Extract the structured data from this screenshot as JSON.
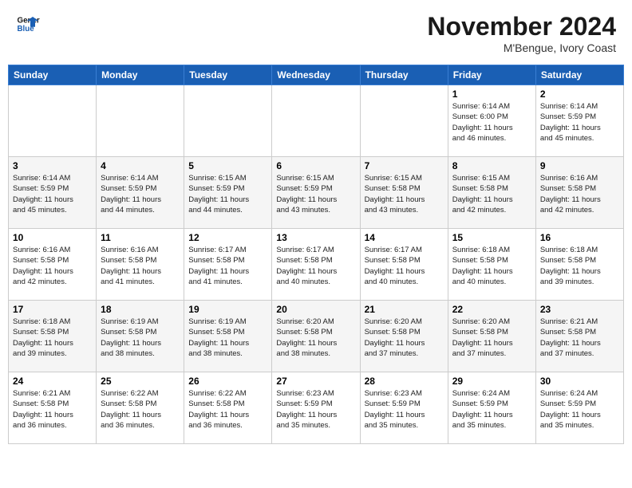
{
  "header": {
    "logo_line1": "General",
    "logo_line2": "Blue",
    "month": "November 2024",
    "location": "M'Bengue, Ivory Coast"
  },
  "days_of_week": [
    "Sunday",
    "Monday",
    "Tuesday",
    "Wednesday",
    "Thursday",
    "Friday",
    "Saturday"
  ],
  "weeks": [
    [
      {
        "day": "",
        "info": ""
      },
      {
        "day": "",
        "info": ""
      },
      {
        "day": "",
        "info": ""
      },
      {
        "day": "",
        "info": ""
      },
      {
        "day": "",
        "info": ""
      },
      {
        "day": "1",
        "info": "Sunrise: 6:14 AM\nSunset: 6:00 PM\nDaylight: 11 hours\nand 46 minutes."
      },
      {
        "day": "2",
        "info": "Sunrise: 6:14 AM\nSunset: 5:59 PM\nDaylight: 11 hours\nand 45 minutes."
      }
    ],
    [
      {
        "day": "3",
        "info": "Sunrise: 6:14 AM\nSunset: 5:59 PM\nDaylight: 11 hours\nand 45 minutes."
      },
      {
        "day": "4",
        "info": "Sunrise: 6:14 AM\nSunset: 5:59 PM\nDaylight: 11 hours\nand 44 minutes."
      },
      {
        "day": "5",
        "info": "Sunrise: 6:15 AM\nSunset: 5:59 PM\nDaylight: 11 hours\nand 44 minutes."
      },
      {
        "day": "6",
        "info": "Sunrise: 6:15 AM\nSunset: 5:59 PM\nDaylight: 11 hours\nand 43 minutes."
      },
      {
        "day": "7",
        "info": "Sunrise: 6:15 AM\nSunset: 5:58 PM\nDaylight: 11 hours\nand 43 minutes."
      },
      {
        "day": "8",
        "info": "Sunrise: 6:15 AM\nSunset: 5:58 PM\nDaylight: 11 hours\nand 42 minutes."
      },
      {
        "day": "9",
        "info": "Sunrise: 6:16 AM\nSunset: 5:58 PM\nDaylight: 11 hours\nand 42 minutes."
      }
    ],
    [
      {
        "day": "10",
        "info": "Sunrise: 6:16 AM\nSunset: 5:58 PM\nDaylight: 11 hours\nand 42 minutes."
      },
      {
        "day": "11",
        "info": "Sunrise: 6:16 AM\nSunset: 5:58 PM\nDaylight: 11 hours\nand 41 minutes."
      },
      {
        "day": "12",
        "info": "Sunrise: 6:17 AM\nSunset: 5:58 PM\nDaylight: 11 hours\nand 41 minutes."
      },
      {
        "day": "13",
        "info": "Sunrise: 6:17 AM\nSunset: 5:58 PM\nDaylight: 11 hours\nand 40 minutes."
      },
      {
        "day": "14",
        "info": "Sunrise: 6:17 AM\nSunset: 5:58 PM\nDaylight: 11 hours\nand 40 minutes."
      },
      {
        "day": "15",
        "info": "Sunrise: 6:18 AM\nSunset: 5:58 PM\nDaylight: 11 hours\nand 40 minutes."
      },
      {
        "day": "16",
        "info": "Sunrise: 6:18 AM\nSunset: 5:58 PM\nDaylight: 11 hours\nand 39 minutes."
      }
    ],
    [
      {
        "day": "17",
        "info": "Sunrise: 6:18 AM\nSunset: 5:58 PM\nDaylight: 11 hours\nand 39 minutes."
      },
      {
        "day": "18",
        "info": "Sunrise: 6:19 AM\nSunset: 5:58 PM\nDaylight: 11 hours\nand 38 minutes."
      },
      {
        "day": "19",
        "info": "Sunrise: 6:19 AM\nSunset: 5:58 PM\nDaylight: 11 hours\nand 38 minutes."
      },
      {
        "day": "20",
        "info": "Sunrise: 6:20 AM\nSunset: 5:58 PM\nDaylight: 11 hours\nand 38 minutes."
      },
      {
        "day": "21",
        "info": "Sunrise: 6:20 AM\nSunset: 5:58 PM\nDaylight: 11 hours\nand 37 minutes."
      },
      {
        "day": "22",
        "info": "Sunrise: 6:20 AM\nSunset: 5:58 PM\nDaylight: 11 hours\nand 37 minutes."
      },
      {
        "day": "23",
        "info": "Sunrise: 6:21 AM\nSunset: 5:58 PM\nDaylight: 11 hours\nand 37 minutes."
      }
    ],
    [
      {
        "day": "24",
        "info": "Sunrise: 6:21 AM\nSunset: 5:58 PM\nDaylight: 11 hours\nand 36 minutes."
      },
      {
        "day": "25",
        "info": "Sunrise: 6:22 AM\nSunset: 5:58 PM\nDaylight: 11 hours\nand 36 minutes."
      },
      {
        "day": "26",
        "info": "Sunrise: 6:22 AM\nSunset: 5:58 PM\nDaylight: 11 hours\nand 36 minutes."
      },
      {
        "day": "27",
        "info": "Sunrise: 6:23 AM\nSunset: 5:59 PM\nDaylight: 11 hours\nand 35 minutes."
      },
      {
        "day": "28",
        "info": "Sunrise: 6:23 AM\nSunset: 5:59 PM\nDaylight: 11 hours\nand 35 minutes."
      },
      {
        "day": "29",
        "info": "Sunrise: 6:24 AM\nSunset: 5:59 PM\nDaylight: 11 hours\nand 35 minutes."
      },
      {
        "day": "30",
        "info": "Sunrise: 6:24 AM\nSunset: 5:59 PM\nDaylight: 11 hours\nand 35 minutes."
      }
    ]
  ]
}
